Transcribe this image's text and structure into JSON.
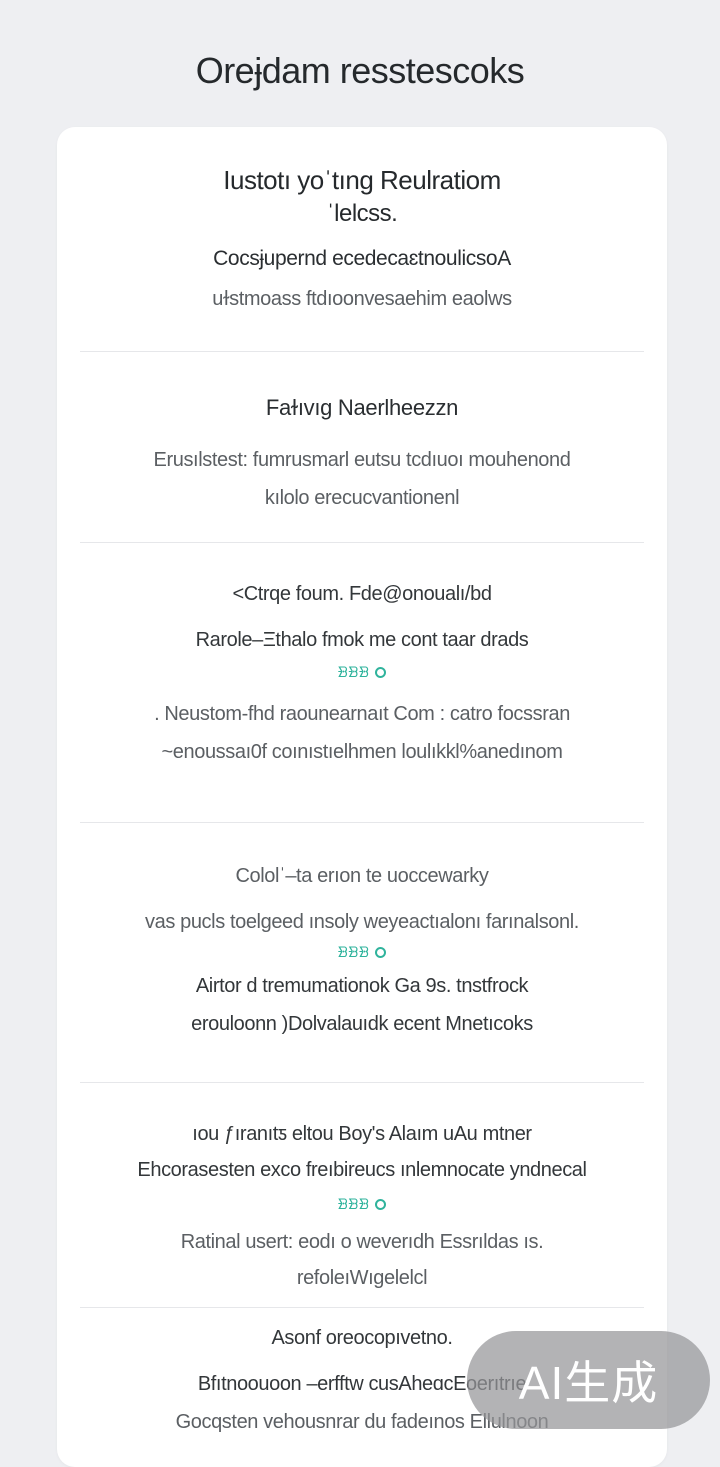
{
  "app": {
    "title": "Oreɉdam resstescoks"
  },
  "sections": [
    {
      "title_lines": [
        "Iustotı yoˈtıng Reulratiom",
        "ˈlelcss."
      ],
      "lines": [
        "Cocsɉupernd ecedecaɛtnoulicsoA",
        "uɫstmoass ftdıoonvesaehim eaolws"
      ]
    },
    {
      "title": "Faɫıvıg Naerlheezzn",
      "lines": [
        "Erusılstest: fumrusmarl eutsu tcdıuoı mouhenond",
        "kılolo erecucvantionenl"
      ]
    },
    {
      "title": "˂Ctrqe foum. Fde@onoualı/bd",
      "line1": "Rarole–Ξthalo fmok me cont taar drads",
      "meta": "ᗿᗿᗿ",
      "lines": [
        ". Neustom-fhd raounearnaıt Com : catro focssran",
        "~enoussaı0f coınıstıelhmen loulıkkl%anedınom"
      ]
    },
    {
      "title": "Cololˈ–ta erıon te uoccewarky",
      "line1": "vas pucls toelgeed ınsoly weyeactıalonı farınalsonl.",
      "meta": "ᗿᗿᗿ",
      "lines": [
        "Airtor d tremumationok  Ga  9s. tnstfrock",
        "erouloonn )Dolvalauıdk  ecent Mnetıcoks"
      ]
    },
    {
      "title": "ıou ƒıranıtƽ eltou Boy's Alaım uAu mtner",
      "line1": "Ehcorasesten exco freıbireucs ınlemnocate yndnecal",
      "meta": "ᗿᗿᗿ",
      "lines": [
        "Ratinal usert: eodı o weverıdh Essrıldas ıs.",
        "refoleıWıgelelcl"
      ]
    },
    {
      "title": "Asonf oreocopıvetno.",
      "lines": [
        "Bfıtnoouoon –erfftw cusAheɑcEoerıtrıe",
        "Gocqsten vehousnrar du fadeınos Ellulnoon"
      ]
    }
  ],
  "badge": {
    "text": "AI生成"
  },
  "colors": {
    "accent": "#2fb39c",
    "background": "#eeeff2",
    "card": "#ffffff",
    "divider": "#e6e7ea"
  },
  "icons": {
    "meta_icon": "circle-ring-icon"
  }
}
